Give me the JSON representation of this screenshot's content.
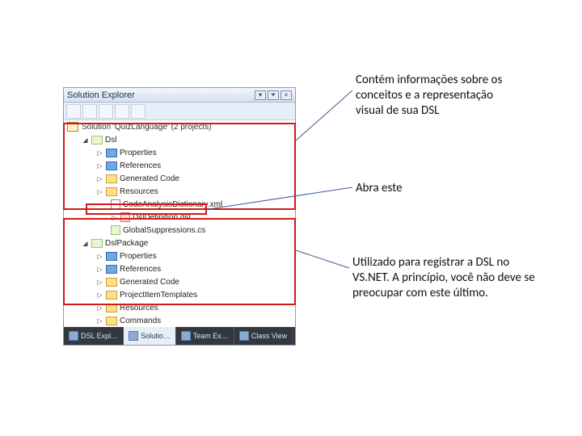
{
  "panel": {
    "title": "Solution Explorer",
    "solution_line": "Solution 'QuizLanguage' (2 projects)"
  },
  "proj1": {
    "name": "Dsl",
    "items": [
      "Properties",
      "References",
      "Generated Code",
      "Resources",
      "CodeAnalysisDictionary.xml",
      "DslDefinition.dsl",
      "GlobalSuppressions.cs"
    ]
  },
  "proj2": {
    "name": "DslPackage",
    "items": [
      "Properties",
      "References",
      "Generated Code",
      "ProjectItemTemplates",
      "Resources",
      "Commands"
    ]
  },
  "tabs": [
    "DSL Expl…",
    "Solutio…",
    "Team Ex…",
    "Class View"
  ],
  "callouts": {
    "c1": "Contém informações sobre os conceitos e a representação visual de sua DSL",
    "c2": "Abra este",
    "c3": "Utilizado para registrar a DSL no VS.NET. A princípio, você não deve se preocupar com este último."
  }
}
